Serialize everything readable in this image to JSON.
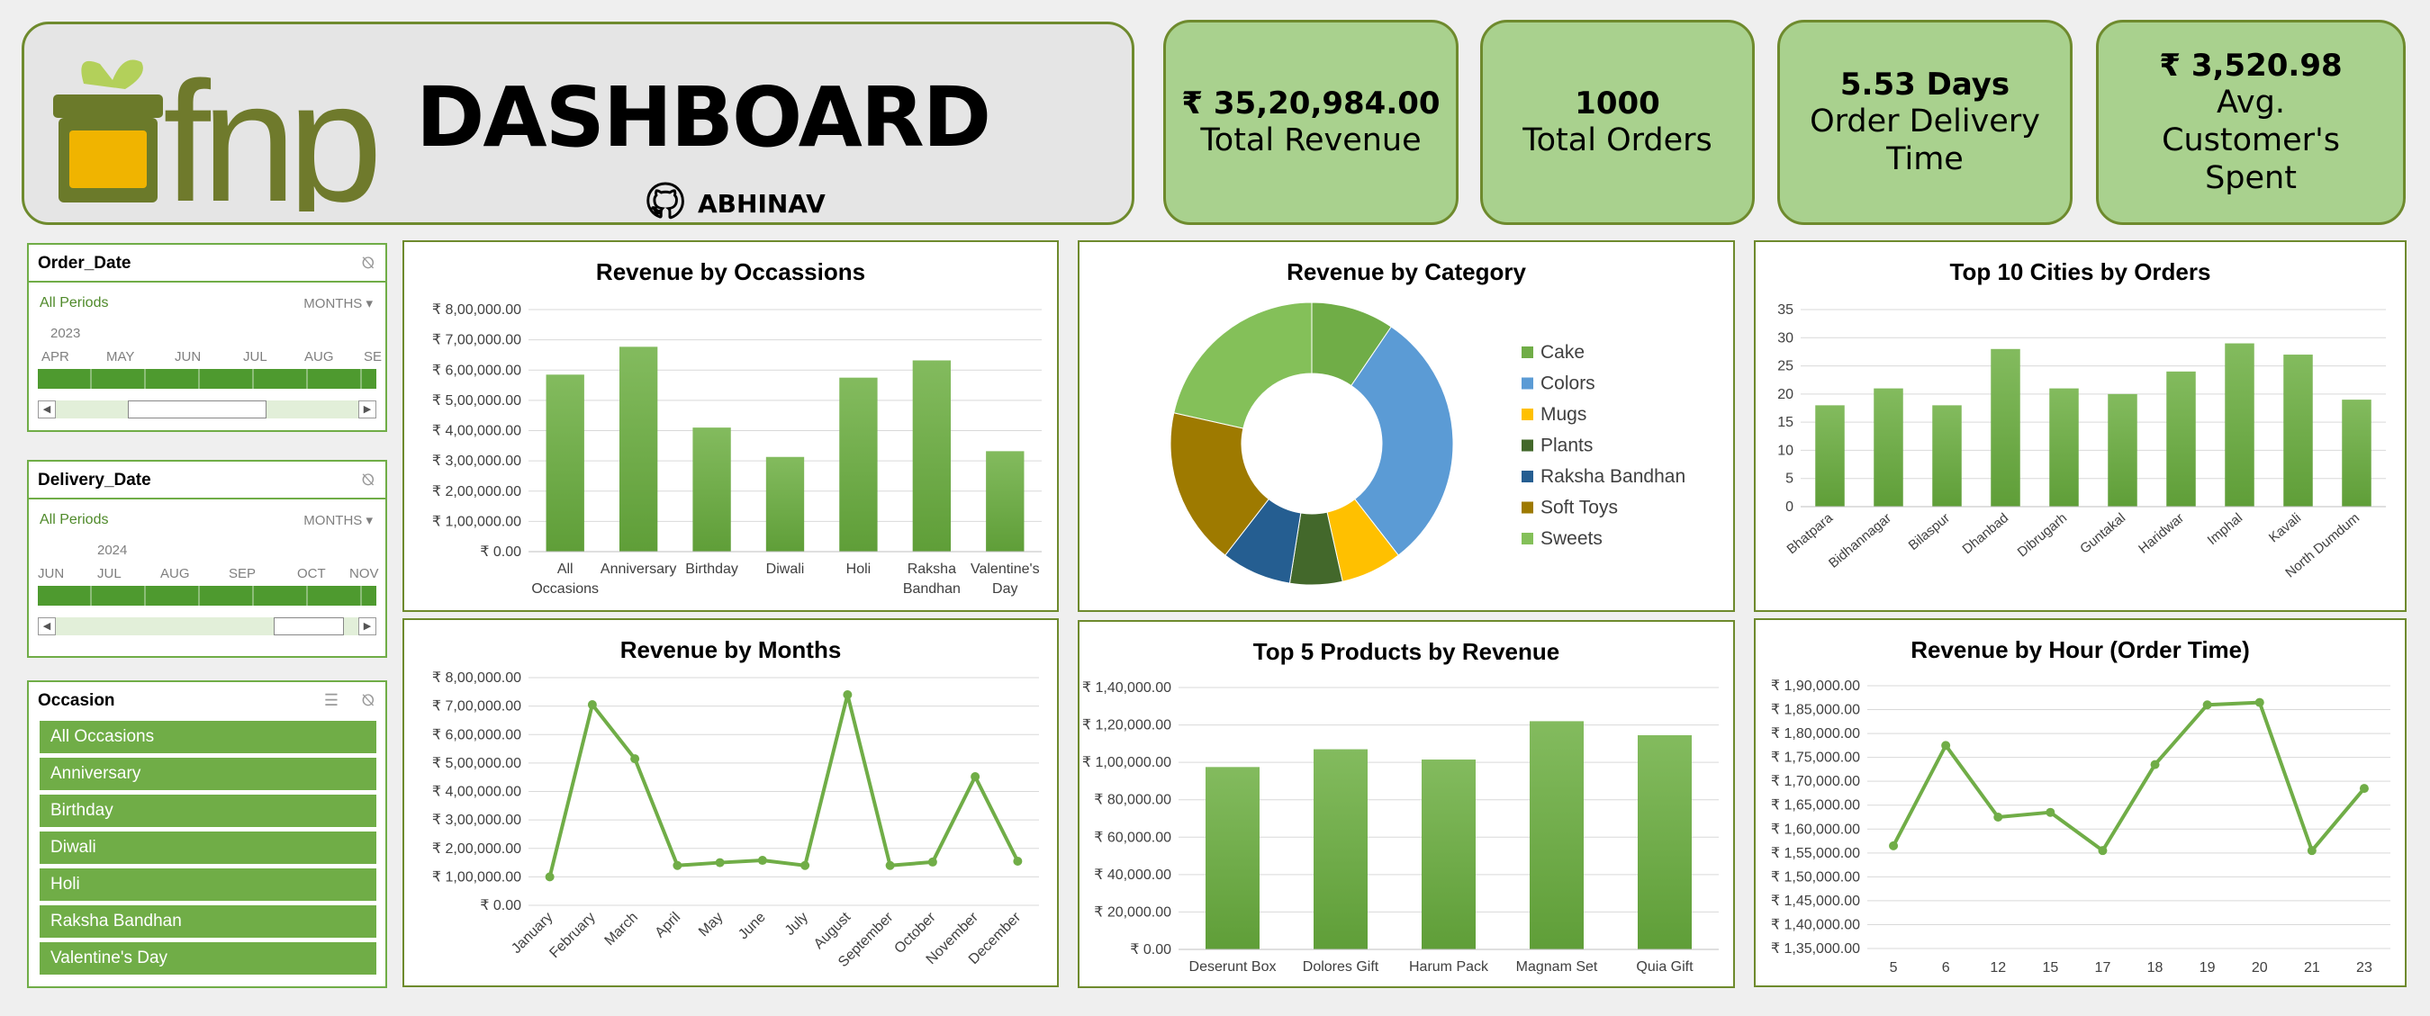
{
  "header": {
    "logo_text": "fnp",
    "title": "DASHBOARD",
    "author": "ABHINAV"
  },
  "kpis": [
    {
      "value": "₹ 35,20,984.00",
      "label": "Total Revenue"
    },
    {
      "value": "1000",
      "label": "Total Orders"
    },
    {
      "value": "5.53 Days",
      "label": "Order Delivery Time"
    },
    {
      "value": "₹ 3,520.98",
      "label": "Avg. Customer's Spent"
    }
  ],
  "slicers": {
    "order_date": {
      "title": "Order_Date",
      "all": "All Periods",
      "unit": "MONTHS",
      "year": "2023",
      "months": [
        "APR",
        "MAY",
        "JUN",
        "JUL",
        "AUG",
        "SE"
      ]
    },
    "delivery_date": {
      "title": "Delivery_Date",
      "all": "All Periods",
      "unit": "MONTHS",
      "year": "2024",
      "months": [
        "JUN",
        "JUL",
        "AUG",
        "SEP",
        "OCT",
        "NOV"
      ]
    },
    "occasion": {
      "title": "Occasion",
      "items": [
        "All Occasions",
        "Anniversary",
        "Birthday",
        "Diwali",
        "Holi",
        "Raksha Bandhan",
        "Valentine's Day"
      ]
    }
  },
  "colors": {
    "green": "#70ad47",
    "dark_green": "#6e8a2d",
    "kpi_fill": "#a9d18e"
  },
  "chart_data": [
    {
      "id": "occasions",
      "type": "bar",
      "title": "Revenue by Occassions",
      "categories": [
        "All Occasions",
        "Anniversary",
        "Birthday",
        "Diwali",
        "Holi",
        "Raksha Bandhan",
        "Valentine's Day"
      ],
      "values": [
        585000,
        677000,
        410000,
        313000,
        575000,
        632000,
        332000
      ],
      "ylim": [
        0,
        800000
      ],
      "yticks": [
        "₹ 0.00",
        "₹ 1,00,000.00",
        "₹ 2,00,000.00",
        "₹ 3,00,000.00",
        "₹ 4,00,000.00",
        "₹ 5,00,000.00",
        "₹ 6,00,000.00",
        "₹ 7,00,000.00",
        "₹ 8,00,000.00"
      ]
    },
    {
      "id": "category",
      "type": "pie",
      "title": "Revenue by Category",
      "categories": [
        "Cake",
        "Colors",
        "Mugs",
        "Plants",
        "Raksha Bandhan",
        "Soft Toys",
        "Sweets"
      ],
      "values": [
        9.5,
        30,
        7,
        6,
        8,
        18,
        21.5
      ],
      "colors": [
        "#70ad47",
        "#5b9bd5",
        "#ffc000",
        "#43682b",
        "#255e91",
        "#9e7a00",
        "#84c059"
      ],
      "legend": "right"
    },
    {
      "id": "cities",
      "type": "bar",
      "title": "Top 10 Cities by Orders",
      "categories": [
        "Bhatpara",
        "Bidhannagar",
        "Bilaspur",
        "Dhanbad",
        "Dibrugarh",
        "Guntakal",
        "Haridwar",
        "Imphal",
        "Kavali",
        "North Dumdum"
      ],
      "values": [
        18,
        21,
        18,
        28,
        21,
        20,
        24,
        29,
        27,
        19
      ],
      "ylim": [
        0,
        35
      ],
      "yticks": [
        "0",
        "5",
        "10",
        "15",
        "20",
        "25",
        "30",
        "35"
      ]
    },
    {
      "id": "months",
      "type": "line",
      "title": "Revenue by Months",
      "categories": [
        "January",
        "February",
        "March",
        "April",
        "May",
        "June",
        "July",
        "August",
        "September",
        "October",
        "November",
        "December"
      ],
      "values": [
        100000,
        705000,
        515000,
        140000,
        150000,
        158000,
        140000,
        740000,
        140000,
        152000,
        452000,
        155000
      ],
      "ylim": [
        0,
        800000
      ],
      "yticks": [
        "₹ 0.00",
        "₹ 1,00,000.00",
        "₹ 2,00,000.00",
        "₹ 3,00,000.00",
        "₹ 4,00,000.00",
        "₹ 5,00,000.00",
        "₹ 6,00,000.00",
        "₹ 7,00,000.00",
        "₹ 8,00,000.00"
      ]
    },
    {
      "id": "products",
      "type": "bar",
      "title": "Top 5 Products by Revenue",
      "categories": [
        "Deserunt Box",
        "Dolores Gift",
        "Harum Pack",
        "Magnam Set",
        "Quia Gift"
      ],
      "values": [
        97500,
        107000,
        101500,
        122000,
        114500
      ],
      "ylim": [
        0,
        140000
      ],
      "yticks": [
        "₹ 0.00",
        "₹ 20,000.00",
        "₹ 40,000.00",
        "₹ 60,000.00",
        "₹ 80,000.00",
        "₹ 1,00,000.00",
        "₹ 1,20,000.00",
        "₹ 1,40,000.00"
      ]
    },
    {
      "id": "hours",
      "type": "line",
      "title": "Revenue by Hour (Order Time)",
      "categories": [
        "5",
        "6",
        "12",
        "15",
        "17",
        "18",
        "19",
        "20",
        "21",
        "23"
      ],
      "values": [
        1565000,
        1775000,
        1625000,
        1635000,
        1555000,
        1735000,
        1860000,
        1865000,
        1555000,
        1685000
      ],
      "ylim": [
        1350000,
        1900000
      ],
      "yticks": [
        "₹ 1,35,000.00",
        "₹ 1,40,000.00",
        "₹ 1,45,000.00",
        "₹ 1,50,000.00",
        "₹ 1,55,000.00",
        "₹ 1,60,000.00",
        "₹ 1,65,000.00",
        "₹ 1,70,000.00",
        "₹ 1,75,000.00",
        "₹ 1,80,000.00",
        "₹ 1,85,000.00",
        "₹ 1,90,000.00"
      ]
    }
  ]
}
